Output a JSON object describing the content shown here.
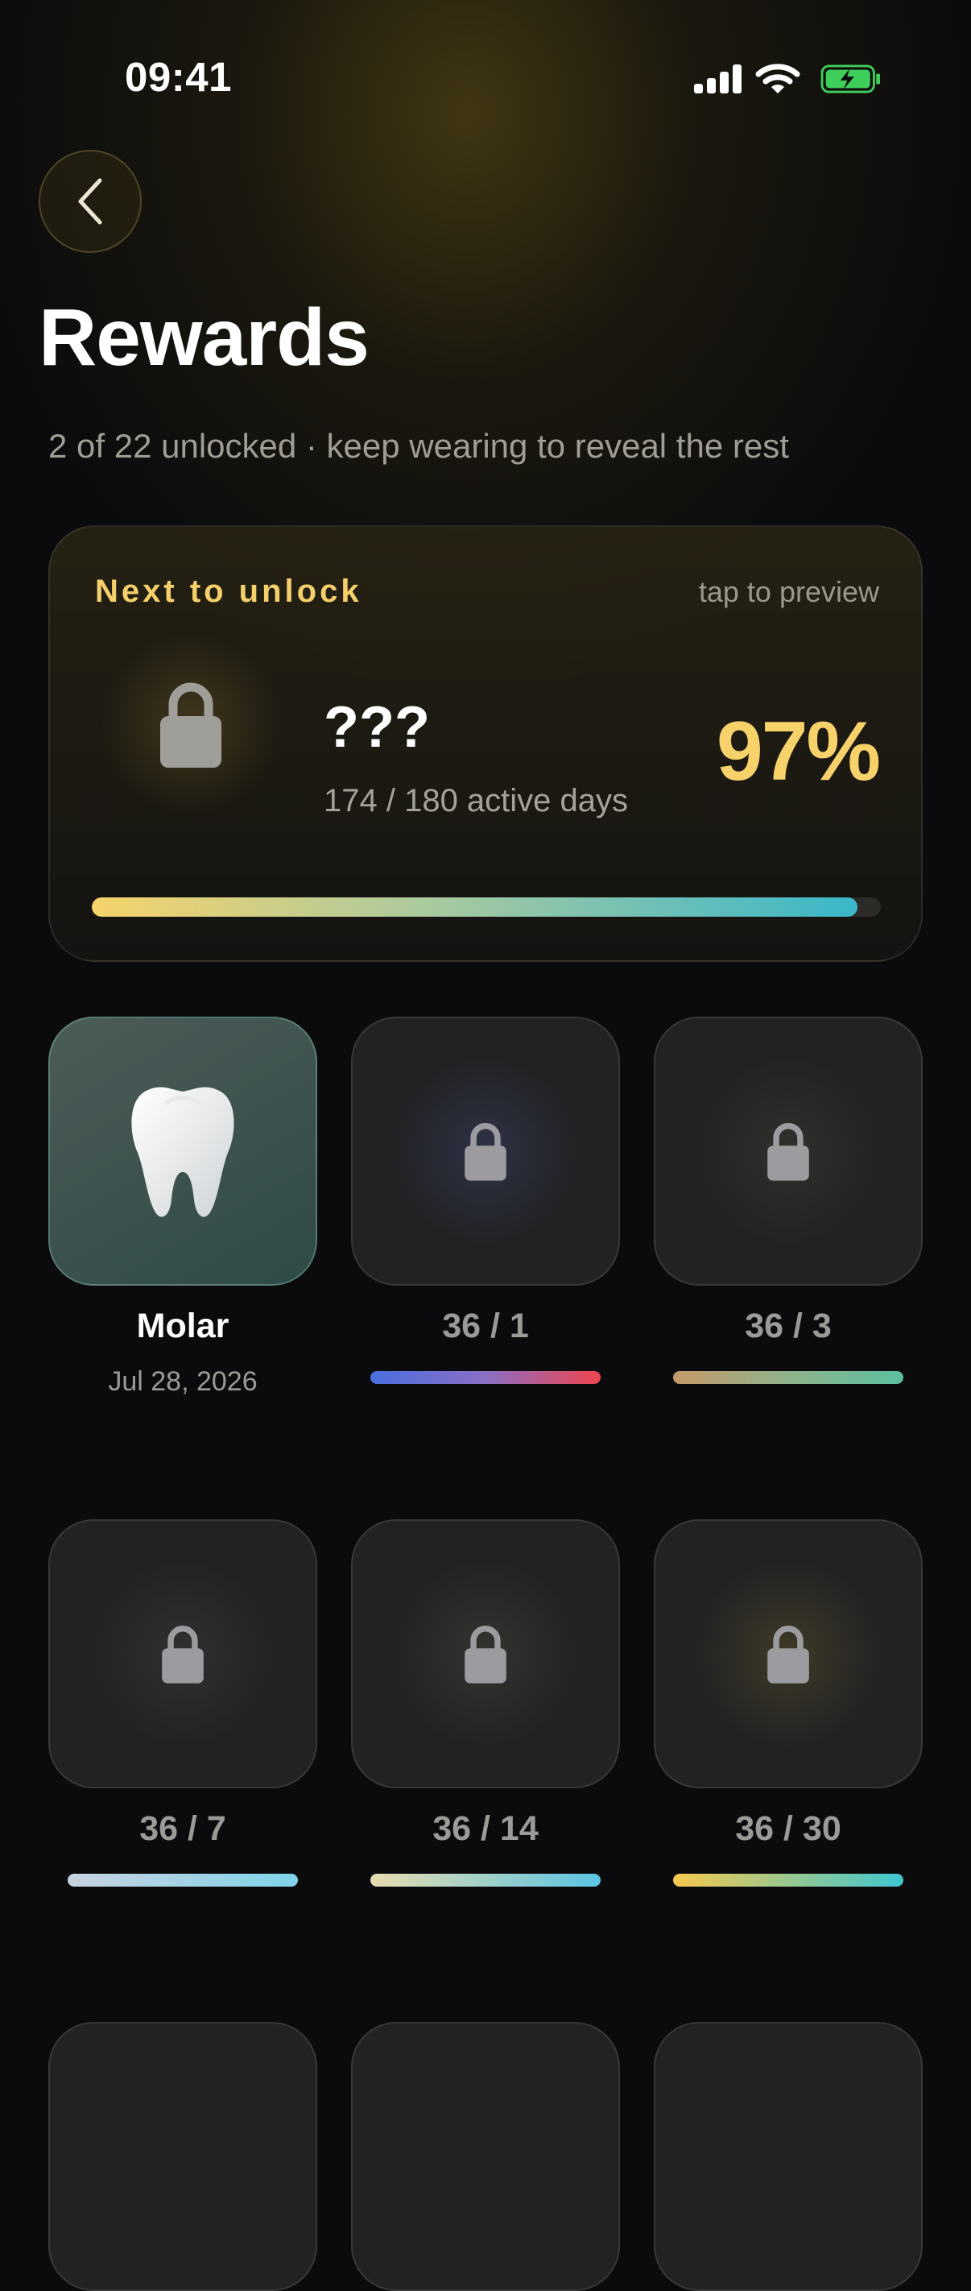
{
  "status_bar": {
    "time": "09:41"
  },
  "header": {
    "title": "Rewards",
    "subtitle": "2 of 22 unlocked · keep wearing to reveal the rest"
  },
  "next_unlock": {
    "label": "Next to unlock",
    "hint": "tap to preview",
    "name": "???",
    "days_text": "174 / 180 active days",
    "percent_text": "97%",
    "progress": 0.97
  },
  "rewards": [
    {
      "state": "unlocked",
      "title": "Molar",
      "date": "Jul 28, 2026",
      "icon": "tooth-icon"
    },
    {
      "state": "locked",
      "progress_text": "36 / 1",
      "icon": "lock-icon",
      "bar_colors": [
        "#4a6fe0",
        "#8b6fc4",
        "#f0454f"
      ]
    },
    {
      "state": "locked",
      "progress_text": "36 / 3",
      "icon": "lock-icon",
      "bar_colors": [
        "#c49a6a",
        "#8fb28c",
        "#5bc0a0"
      ]
    },
    {
      "state": "locked",
      "progress_text": "36 / 7",
      "icon": "lock-icon",
      "bar_colors": [
        "#c9d3e0",
        "#7fd3ea"
      ]
    },
    {
      "state": "locked",
      "progress_text": "36 / 14",
      "icon": "lock-icon",
      "bar_colors": [
        "#e8dcb0",
        "#5ac5e3"
      ]
    },
    {
      "state": "locked",
      "progress_text": "36 / 30",
      "icon": "lock-icon",
      "bar_colors": [
        "#f6c84f",
        "#3ec7d0"
      ]
    }
  ],
  "colors": {
    "accent_gold": "#f7d26a",
    "background": "#0b0b0d",
    "tile_locked": "#222224"
  }
}
